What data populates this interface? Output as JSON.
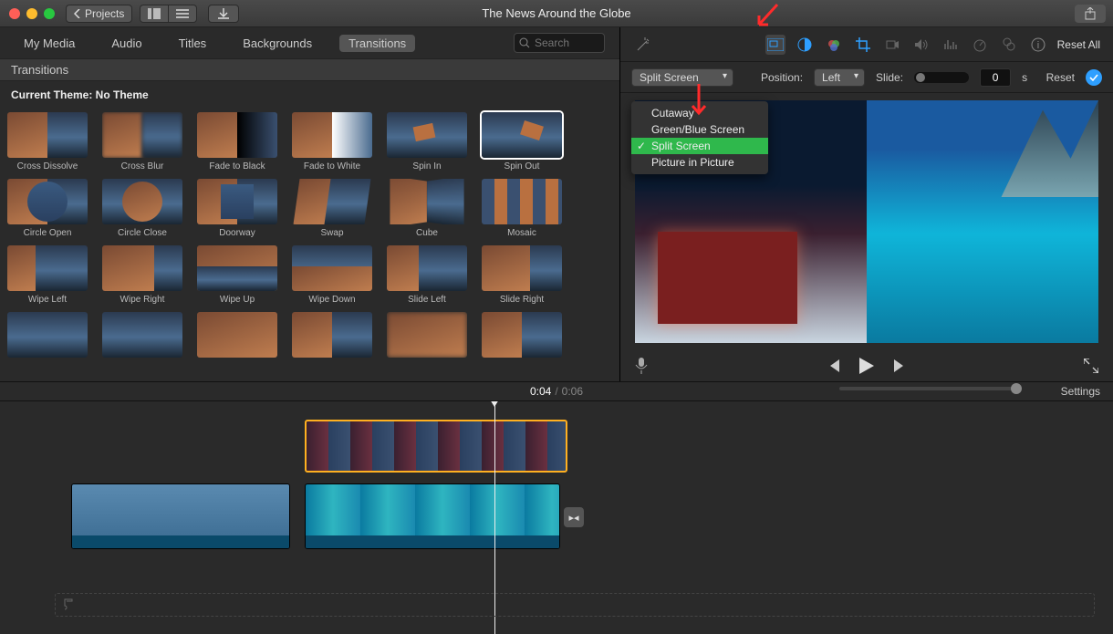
{
  "window_title": "The News Around the Globe",
  "back_button": "Projects",
  "tabs": [
    "My Media",
    "Audio",
    "Titles",
    "Backgrounds",
    "Transitions"
  ],
  "active_tab": "Transitions",
  "search_placeholder": "Search",
  "subheader": "Transitions",
  "theme_label": "Current Theme: No Theme",
  "transitions": [
    [
      "Cross Dissolve",
      "Cross Blur",
      "Fade to Black",
      "Fade to White",
      "Spin In",
      "Spin Out"
    ],
    [
      "Circle Open",
      "Circle Close",
      "Doorway",
      "Swap",
      "Cube",
      "Mosaic"
    ],
    [
      "Wipe Left",
      "Wipe Right",
      "Wipe Up",
      "Wipe Down",
      "Slide Left",
      "Slide Right"
    ],
    [
      "",
      "",
      "",
      "",
      "",
      ""
    ]
  ],
  "viewer_toolbar": {
    "reset_all": "Reset All"
  },
  "overlay": {
    "select_value": "Split Screen",
    "options": [
      "Cutaway",
      "Green/Blue Screen",
      "Split Screen",
      "Picture in Picture"
    ],
    "selected_option": "Split Screen",
    "position_label": "Position:",
    "position_value": "Left",
    "slide_label": "Slide:",
    "slide_value": "0",
    "slide_unit": "s",
    "reset": "Reset"
  },
  "playtime": {
    "current": "0:04",
    "separator": "/",
    "total": "0:06"
  },
  "settings_label": "Settings"
}
